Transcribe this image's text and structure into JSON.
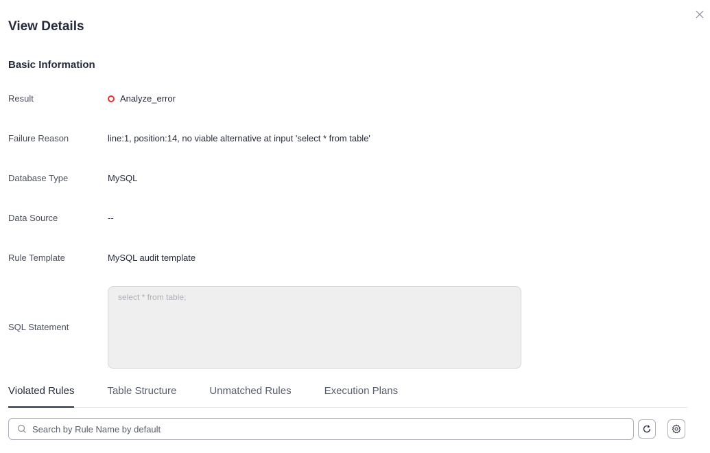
{
  "dialog": {
    "title": "View Details",
    "close_icon": "close-icon"
  },
  "basic_info": {
    "heading": "Basic Information",
    "result": {
      "label": "Result",
      "value": "Analyze_error",
      "status_color": "#e8302f"
    },
    "failure_reason": {
      "label": "Failure Reason",
      "value": "line:1, position:14, no viable alternative at input 'select * from table'"
    },
    "database_type": {
      "label": "Database Type",
      "value": "MySQL"
    },
    "data_source": {
      "label": "Data Source",
      "value": "--"
    },
    "rule_template": {
      "label": "Rule Template",
      "value": "MySQL audit template"
    },
    "sql_statement": {
      "label": "SQL Statement",
      "value": "select * from table;"
    }
  },
  "tabs": [
    {
      "label": "Violated Rules",
      "active": true
    },
    {
      "label": "Table Structure",
      "active": false
    },
    {
      "label": "Unmatched Rules",
      "active": false
    },
    {
      "label": "Execution Plans",
      "active": false
    }
  ],
  "search": {
    "placeholder": "Search by Rule Name by default",
    "icon": "search-icon"
  },
  "toolbar": {
    "refresh_icon": "refresh-icon",
    "settings_icon": "gear-icon"
  },
  "colors": {
    "error": "#e8302f",
    "link": "#1f71ff",
    "text": "#252b3a"
  }
}
